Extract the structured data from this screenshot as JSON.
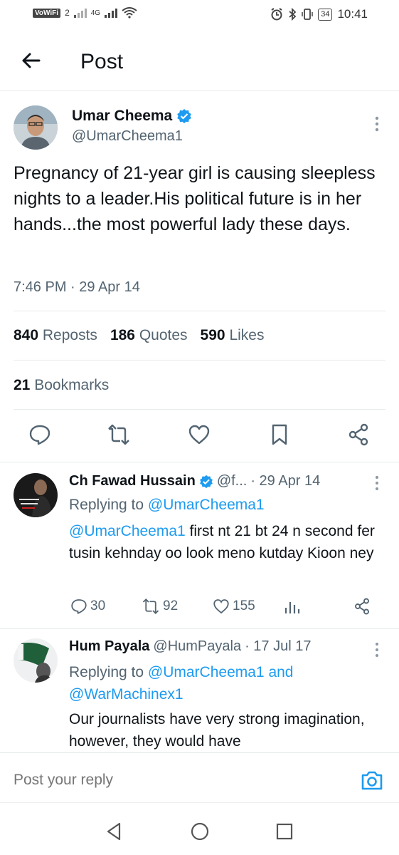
{
  "status_bar": {
    "left": {
      "wifi_label": "VoWiFi",
      "sim": "2",
      "network": "4G"
    },
    "right": {
      "battery": "34",
      "time": "10:41"
    }
  },
  "header": {
    "title": "Post",
    "back_icon": "arrow-left-icon"
  },
  "main_tweet": {
    "author_name": "Umar Cheema",
    "author_handle": "@UmarCheema1",
    "text": "Pregnancy of 21-year girl is causing sleepless nights to a leader.His political future is in her hands...the most powerful lady these days.",
    "timestamp": "7:46 PM · 29 Apr 14",
    "stats": {
      "reposts_count": "840",
      "reposts_label": "Reposts",
      "quotes_count": "186",
      "quotes_label": "Quotes",
      "likes_count": "590",
      "likes_label": "Likes",
      "bookmarks_count": "21",
      "bookmarks_label": "Bookmarks"
    },
    "actions": [
      "reply-icon",
      "repost-icon",
      "like-icon",
      "bookmark-icon",
      "share-icon"
    ]
  },
  "replies": [
    {
      "name": "Ch Fawad Hussain",
      "handle": "@f...",
      "date": "· 29 Apr 14",
      "replying_label": "Replying to",
      "replying_to": "@UmarCheema1",
      "mention": "@UmarCheema1",
      "text": " first nt 21 bt 24 n second fer tusin kehnday oo look meno kutday Kioon ney",
      "replies": "30",
      "reposts": "92",
      "likes": "155"
    },
    {
      "name": "Hum Payala",
      "handle": "@HumPayala",
      "date": "· 17 Jul 17",
      "replying_label": "Replying to",
      "replying_to": "@UmarCheema1 and",
      "replying_to_2": "@WarMachinex1",
      "text": "Our journalists have very strong imagination, however, they would have"
    }
  ],
  "reply_bar": {
    "placeholder": "Post your reply"
  },
  "colors": {
    "accent": "#1d9bf0",
    "text": "#0f1419",
    "secondary": "#536471",
    "divider": "#e6e9eb"
  }
}
